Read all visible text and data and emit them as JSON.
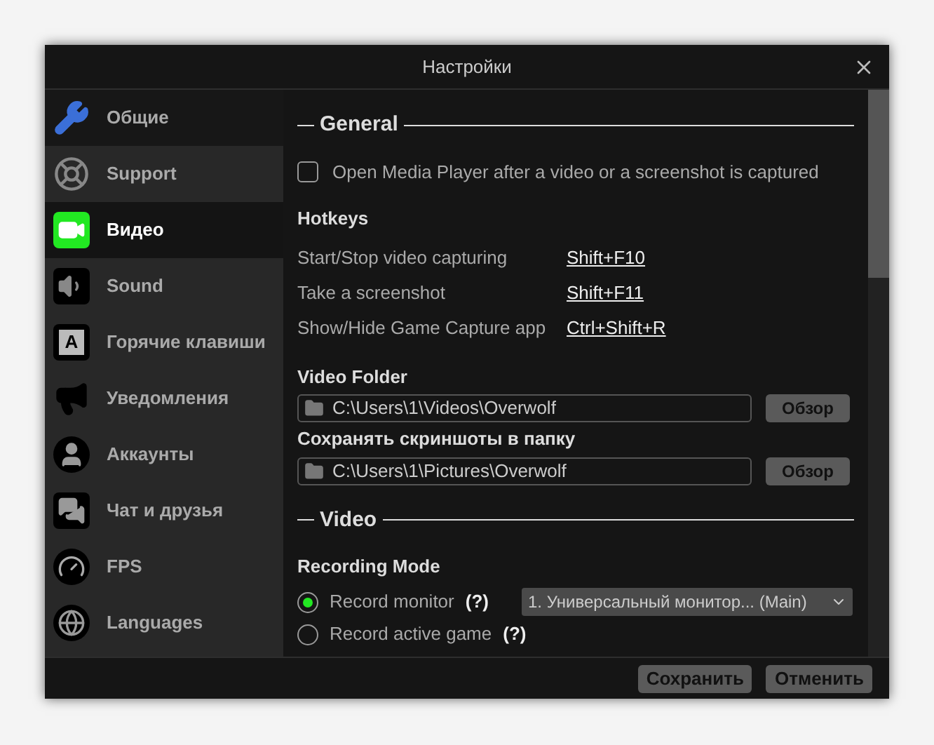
{
  "window": {
    "title": "Настройки"
  },
  "sidebar": {
    "items": [
      {
        "kind": "wrench",
        "label": "Общие",
        "selected": false,
        "hovered": true
      },
      {
        "kind": "lifebuoy",
        "label": "Support",
        "selected": false,
        "hovered": false
      },
      {
        "kind": "video",
        "label": "Видео",
        "selected": true,
        "hovered": false
      },
      {
        "kind": "sound",
        "label": "Sound",
        "selected": false,
        "hovered": false
      },
      {
        "kind": "key",
        "label": "Горячие клавиши",
        "icon_letter": "A",
        "selected": false,
        "hovered": false
      },
      {
        "kind": "megaphone",
        "label": "Уведомления",
        "selected": false,
        "hovered": false
      },
      {
        "kind": "user",
        "label": "Аккаунты",
        "selected": false,
        "hovered": false
      },
      {
        "kind": "chat",
        "label": "Чат и друзья",
        "selected": false,
        "hovered": false
      },
      {
        "kind": "gauge",
        "label": "FPS",
        "selected": false,
        "hovered": false
      },
      {
        "kind": "globe",
        "label": "Languages",
        "selected": false,
        "hovered": false
      }
    ]
  },
  "general": {
    "heading": "General",
    "open_media_player": {
      "label": "Open Media Player after a video or a screenshot is captured",
      "checked": false
    },
    "hotkeys_heading": "Hotkeys",
    "hotkeys": [
      {
        "action": "Start/Stop video capturing",
        "keys": "Shift+F10"
      },
      {
        "action": "Take a screenshot",
        "keys": "Shift+F11"
      },
      {
        "action": "Show/Hide Game Capture app",
        "keys": "Ctrl+Shift+R"
      }
    ],
    "folders": [
      {
        "label": "Video Folder",
        "path": "C:\\Users\\1\\Videos\\Overwolf",
        "button": "Обзор"
      },
      {
        "label": "Сохранять скриншоты в папку",
        "path": "C:\\Users\\1\\Pictures\\Overwolf",
        "button": "Обзор"
      }
    ]
  },
  "video": {
    "heading": "Video",
    "recording_mode_heading": "Recording Mode",
    "modes": [
      {
        "label": "Record monitor",
        "help": "(?)",
        "selected": true,
        "dropdown": "1. Универсальный монитор... (Main)"
      },
      {
        "label": "Record active game",
        "help": "(?)",
        "selected": false
      }
    ]
  },
  "buttons": [
    "Сохранить",
    "Отменить"
  ]
}
